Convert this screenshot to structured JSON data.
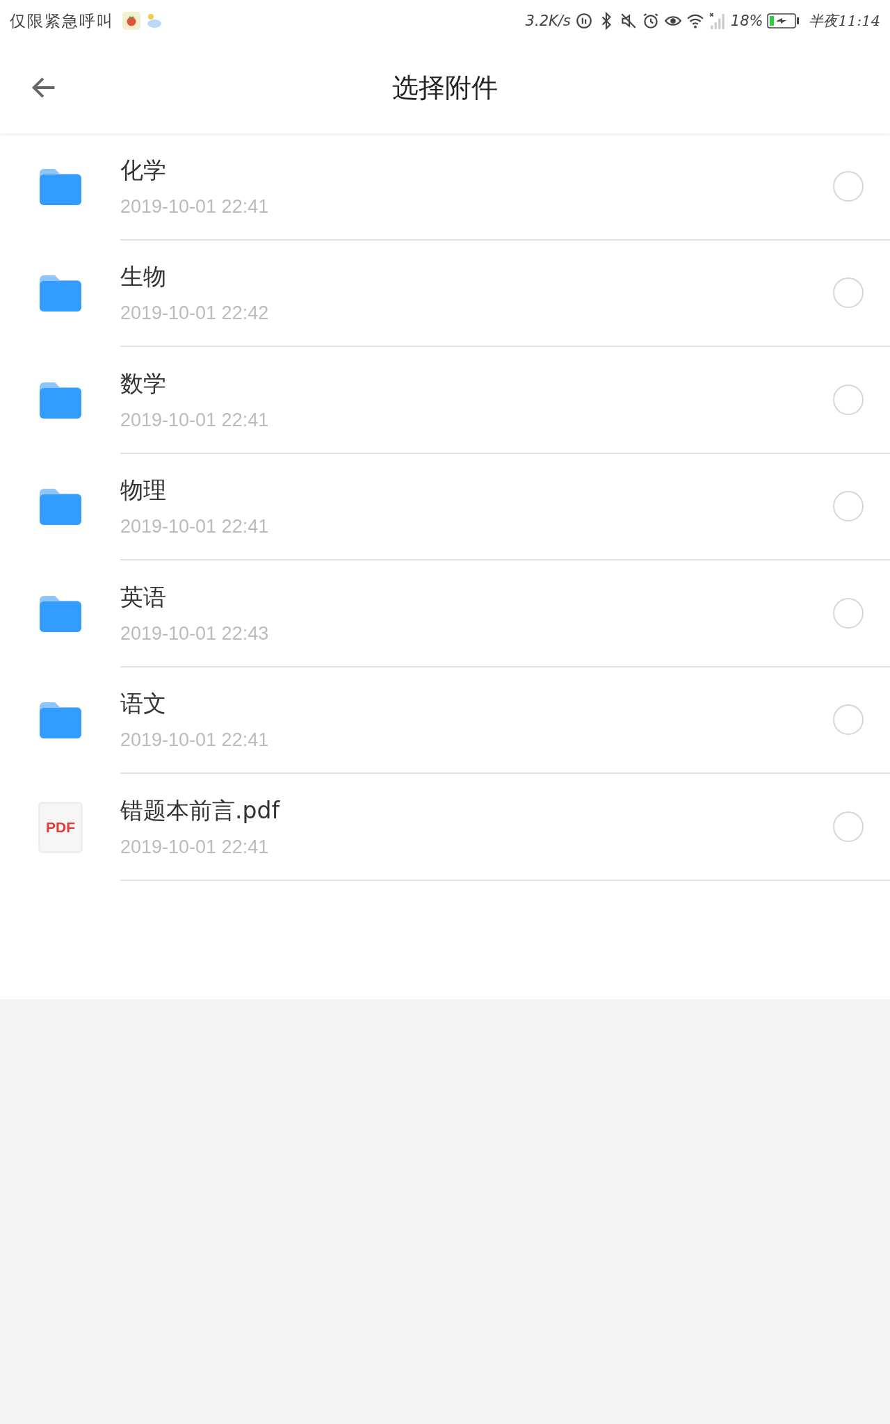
{
  "status_bar": {
    "carrier": "仅限紧急呼叫",
    "speed": "3.2K/s",
    "battery": "18%",
    "time": "半夜11:14"
  },
  "app_bar": {
    "title": "选择附件"
  },
  "files": [
    {
      "kind": "folder",
      "name": "化学",
      "date": "2019-10-01 22:41",
      "selected": false
    },
    {
      "kind": "folder",
      "name": "生物",
      "date": "2019-10-01 22:42",
      "selected": false
    },
    {
      "kind": "folder",
      "name": "数学",
      "date": "2019-10-01 22:41",
      "selected": false
    },
    {
      "kind": "folder",
      "name": "物理",
      "date": "2019-10-01 22:41",
      "selected": false
    },
    {
      "kind": "folder",
      "name": "英语",
      "date": "2019-10-01 22:43",
      "selected": false
    },
    {
      "kind": "folder",
      "name": "语文",
      "date": "2019-10-01 22:41",
      "selected": false
    },
    {
      "kind": "pdf",
      "badge": "PDF",
      "name": "错题本前言.pdf",
      "date": "2019-10-01 22:41",
      "selected": false
    }
  ]
}
